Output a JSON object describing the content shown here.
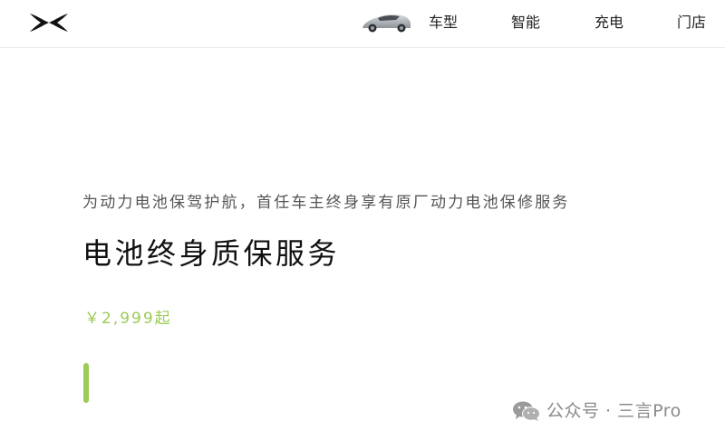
{
  "header": {
    "logo_icon": "xpeng-x-logo-icon",
    "car_thumbnail_icon": "car-thumbnail-icon",
    "nav": [
      {
        "label": "车型"
      },
      {
        "label": "智能"
      },
      {
        "label": "充电"
      },
      {
        "label": "门店"
      }
    ]
  },
  "hero": {
    "subtitle": "为动力电池保驾护航，首任车主终身享有原厂动力电池保修服务",
    "title": "电池终身质保服务",
    "price": "￥2,999起"
  },
  "watermark": {
    "icon": "wechat-icon",
    "text": "公众号 · 三言Pro"
  },
  "colors": {
    "accent": "#9ccb57",
    "text_primary": "#111111",
    "text_secondary": "#555555",
    "watermark": "#8a8a8a"
  }
}
